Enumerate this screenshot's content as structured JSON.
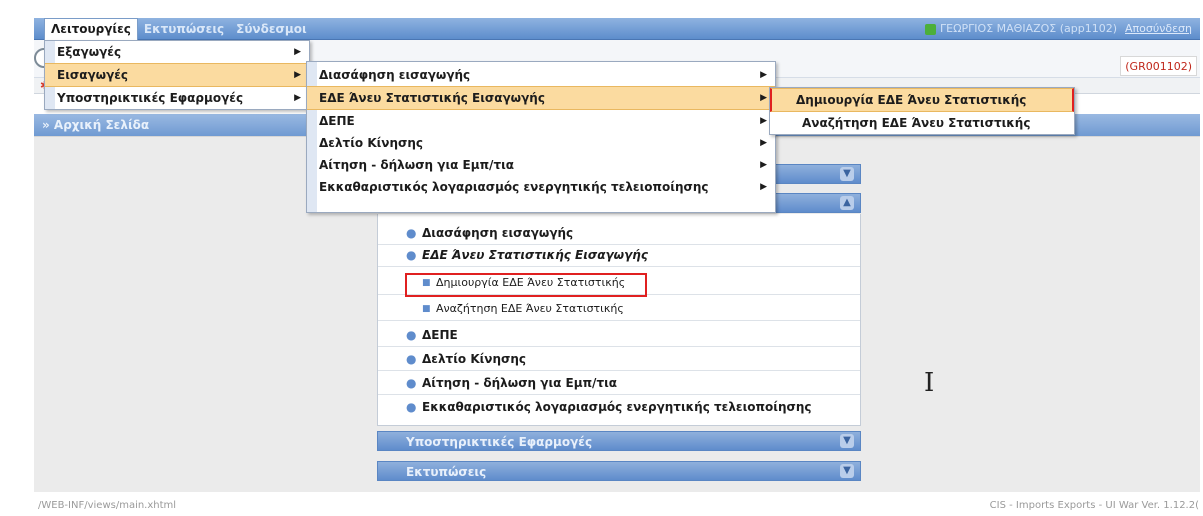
{
  "top_menu": {
    "items": [
      {
        "label": "Λειτουργίες"
      },
      {
        "label": "Εκτυπώσεις"
      },
      {
        "label": "Σύνδεσμοι"
      }
    ]
  },
  "user": {
    "name": "ΓΕΩΡΓΙΟΣ ΜΑΘΙΑΖΟΣ (app1102)",
    "logout": "Αποσύνδεση"
  },
  "office_code": "(GR001102)",
  "page_header": "» Αρχική Σελίδα",
  "menu_level1": [
    {
      "label": "Εξαγωγές"
    },
    {
      "label": "Εισαγωγές"
    },
    {
      "label": "Υποστηρικτικές Εφαρμογές"
    }
  ],
  "menu_level2": [
    {
      "label": "Διασάφηση εισαγωγής"
    },
    {
      "label": "ΕΔΕ Άνευ Στατιστικής Εισαγωγής"
    },
    {
      "label": "ΔΕΠΕ"
    },
    {
      "label": "Δελτίο Κίνησης"
    },
    {
      "label": "Αίτηση - δήλωση για Εμπ/τια"
    },
    {
      "label": "Εκκαθαριστικός λογαριασμός ενεργητικής τελειοποίησης"
    }
  ],
  "menu_level3": [
    {
      "label": "Δημιουργία ΕΔΕ Άνευ Στατιστικής"
    },
    {
      "label": "Αναζήτηση ΕΔΕ Άνευ Στατιστικής"
    }
  ],
  "accordion": {
    "rows": [
      {
        "label": "Διασάφηση εισαγωγής"
      },
      {
        "label": "ΕΔΕ Άνευ Στατιστικής Εισαγωγής"
      },
      {
        "label": "Δημιουργία ΕΔΕ Άνευ Στατιστικής"
      },
      {
        "label": "Αναζήτηση ΕΔΕ Άνευ Στατιστικής"
      },
      {
        "label": "ΔΕΠΕ"
      },
      {
        "label": "Δελτίο Κίνησης"
      },
      {
        "label": "Αίτηση - δήλωση για Εμπ/τια"
      },
      {
        "label": "Εκκαθαριστικός λογαριασμός ενεργητικής τελειοποίησης"
      }
    ],
    "section_support": "Υποστηρικτικές Εφαρμογές",
    "section_prints": "Εκτυπώσεις"
  },
  "footer": {
    "path": "/WEB-INF/views/main.xhtml",
    "version": "CIS - Imports Exports - UI War Ver. 1.12.2("
  },
  "colors": {
    "highlight": "#fbdba0",
    "header_blue": "#5f8ccc",
    "red_marker": "#e02020"
  }
}
